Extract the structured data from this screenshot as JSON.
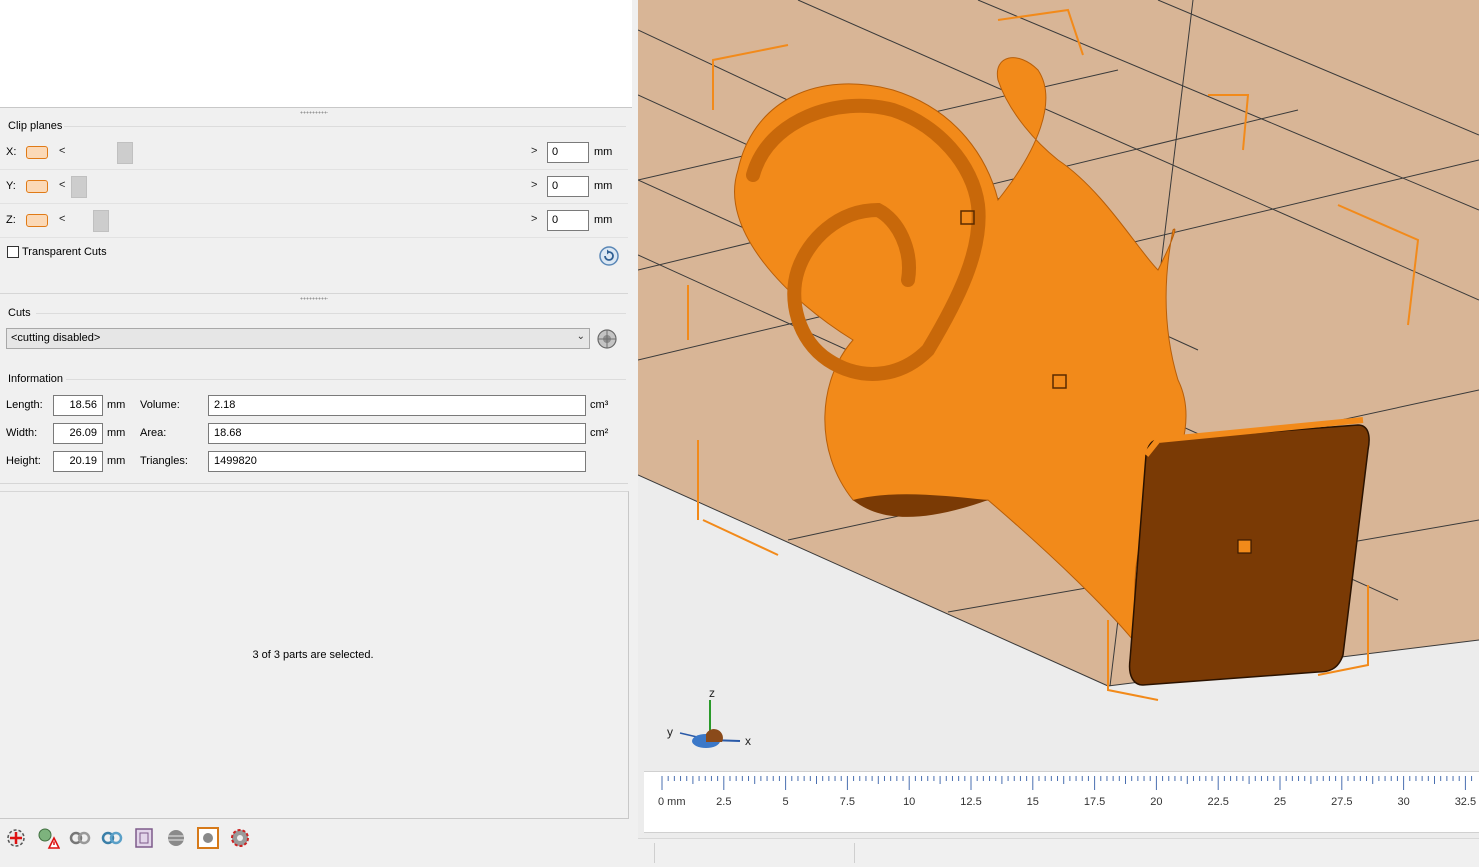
{
  "clip_planes": {
    "title": "Clip planes",
    "rows": [
      {
        "axis": "X:",
        "value": "0",
        "unit": "mm",
        "left_arrow": "<",
        "right_arrow": ">"
      },
      {
        "axis": "Y:",
        "value": "0",
        "unit": "mm",
        "left_arrow": "<",
        "right_arrow": ">"
      },
      {
        "axis": "Z:",
        "value": "0",
        "unit": "mm",
        "left_arrow": "<",
        "right_arrow": ">"
      }
    ],
    "transparent_cuts_label": "Transparent Cuts",
    "transparent_cuts_checked": false
  },
  "cuts": {
    "title": "Cuts",
    "selected": "<cutting disabled>"
  },
  "information": {
    "title": "Information",
    "length_label": "Length:",
    "length_value": "18.56",
    "length_unit": "mm",
    "width_label": "Width:",
    "width_value": "26.09",
    "width_unit": "mm",
    "height_label": "Height:",
    "height_value": "20.19",
    "height_unit": "mm",
    "volume_label": "Volume:",
    "volume_value": "2.18",
    "volume_unit": "cm³",
    "area_label": "Area:",
    "area_value": "18.68",
    "area_unit": "cm²",
    "triangles_label": "Triangles:",
    "triangles_value": "1499820"
  },
  "selection_status": "3 of 3 parts are selected.",
  "axes_widget": {
    "z": "z",
    "y": "y",
    "x": "x"
  },
  "ruler": {
    "labels": [
      "0 mm",
      "2.5",
      "5",
      "7.5",
      "10",
      "12.5",
      "15",
      "17.5",
      "20",
      "22.5",
      "25",
      "27.5",
      "30",
      "32.5"
    ]
  },
  "toolbar_icons": [
    "add-part-icon",
    "fix-warning-icon",
    "unlink-icon",
    "link-icon",
    "shell-icon",
    "sphere-icon",
    "orange-box-icon",
    "gear-red-icon"
  ],
  "colors": {
    "model_orange": "#f28a1a",
    "model_dark": "#7a3a05",
    "platform": "#d8b596",
    "clip_swatch": "#e07a16"
  }
}
